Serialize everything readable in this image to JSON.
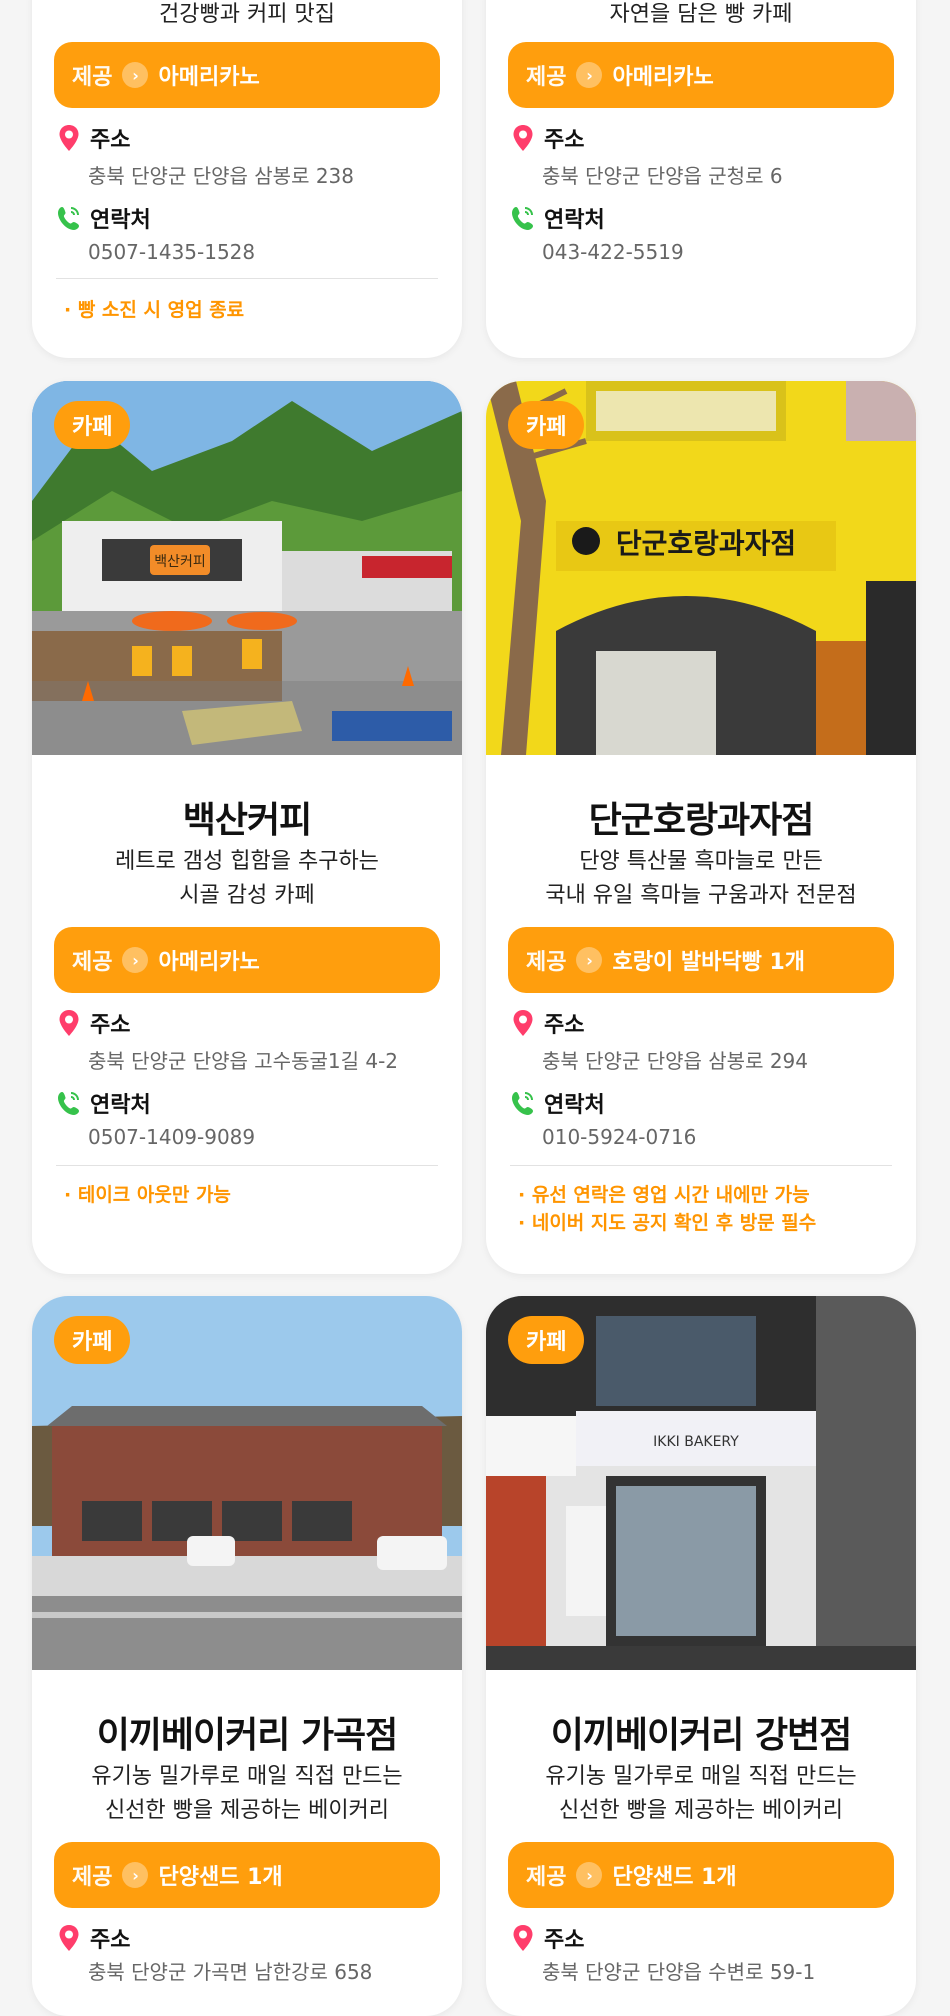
{
  "colors": {
    "accent": "#ff9e0d",
    "note": "#ff9500"
  },
  "top_cards": [
    {
      "desc_tail": "건강빵과 커피 맛집",
      "offer_label": "제공",
      "offer_item": "아메리카노",
      "address_label": "주소",
      "address": "충북 단양군 단양읍 삼봉로 238",
      "contact_label": "연락처",
      "contact": "0507-1435-1528",
      "notes": [
        "· 빵 소진 시 영업 종료"
      ]
    },
    {
      "desc_tail": "자연을 담은 빵 카페",
      "offer_label": "제공",
      "offer_item": "아메리카노",
      "address_label": "주소",
      "address": "충북 단양군 단양읍 군청로 6",
      "contact_label": "연락처",
      "contact": "043-422-5519",
      "notes": []
    }
  ],
  "cards": [
    {
      "category": "카페",
      "name": "백산커피",
      "desc": [
        "레트로 갬성 힙함을 추구하는",
        "시골 감성 카페"
      ],
      "offer_label": "제공",
      "offer_item": "아메리카노",
      "address_label": "주소",
      "address": "충북 단양군 단양읍 고수동굴1길 4-2",
      "contact_label": "연락처",
      "contact": "0507-1409-9089",
      "notes": [
        "· 테이크 아웃만 가능"
      ],
      "sign_text": "백산커피"
    },
    {
      "category": "카페",
      "name": "단군호랑과자점",
      "desc": [
        "단양 특산물 흑마늘로 만든",
        "국내 유일 흑마늘 구움과자 전문점"
      ],
      "offer_label": "제공",
      "offer_item": "호랑이 발바닥빵 1개",
      "address_label": "주소",
      "address": "충북 단양군 단양읍 삼봉로 294",
      "contact_label": "연락처",
      "contact": "010-5924-0716",
      "notes": [
        "· 유선 연락은 영업 시간 내에만 가능",
        "· 네이버 지도 공지 확인 후 방문 필수"
      ],
      "sign_text": "단군호랑과자점"
    },
    {
      "category": "카페",
      "name": "이끼베이커리 가곡점",
      "desc": [
        "유기농 밀가루로 매일 직접 만드는",
        "신선한 빵을 제공하는 베이커리"
      ],
      "offer_label": "제공",
      "offer_item": "단양샌드 1개",
      "address_label": "주소",
      "address": "충북 단양군 가곡면 남한강로 658"
    },
    {
      "category": "카페",
      "name": "이끼베이커리 강변점",
      "desc": [
        "유기농 밀가루로 매일 직접 만드는",
        "신선한 빵을 제공하는 베이커리"
      ],
      "offer_label": "제공",
      "offer_item": "단양샌드 1개",
      "address_label": "주소",
      "address": "충북 단양군 단양읍 수변로 59-1",
      "sign_text": "IKKI BAKERY"
    }
  ]
}
